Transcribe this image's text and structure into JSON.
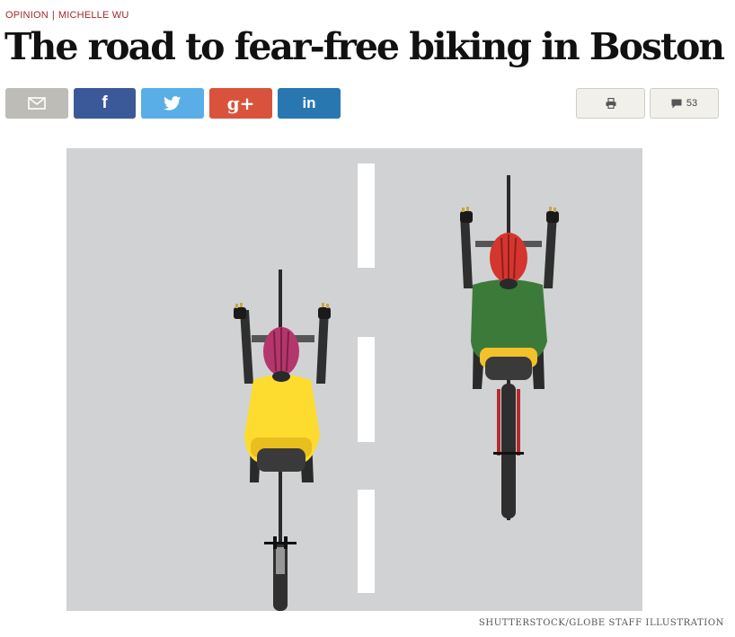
{
  "kicker": {
    "section": "OPINION",
    "separator": "|",
    "author": "MICHELLE WU"
  },
  "headline": "The road to fear-free biking in Boston",
  "share": {
    "email": {
      "icon": "email-icon",
      "color": "#bdbcb6"
    },
    "facebook": {
      "label": "f",
      "icon": "facebook-icon",
      "color": "#3b5998"
    },
    "twitter": {
      "icon": "twitter-icon",
      "color": "#5aaee8"
    },
    "google_plus": {
      "label": "g+",
      "icon": "google-plus-icon",
      "color": "#d9533c"
    },
    "linkedin": {
      "label": "in",
      "icon": "linkedin-icon",
      "color": "#2977b1"
    }
  },
  "utility": {
    "print": {
      "icon": "print-icon"
    },
    "comments": {
      "icon": "comment-icon",
      "count": "53"
    }
  },
  "figure": {
    "credit": "SHUTTERSTOCK/GLOBE STAFF ILLUSTRATION",
    "road_color": "#d1d2d4",
    "cyclist_left": {
      "helmet_color": "#b4366c",
      "jersey_color": "#fddc2f"
    },
    "cyclist_right": {
      "helmet_color": "#d4352f",
      "jersey_color": "#3c7a3a",
      "bike_color": "#b42c2e"
    }
  }
}
